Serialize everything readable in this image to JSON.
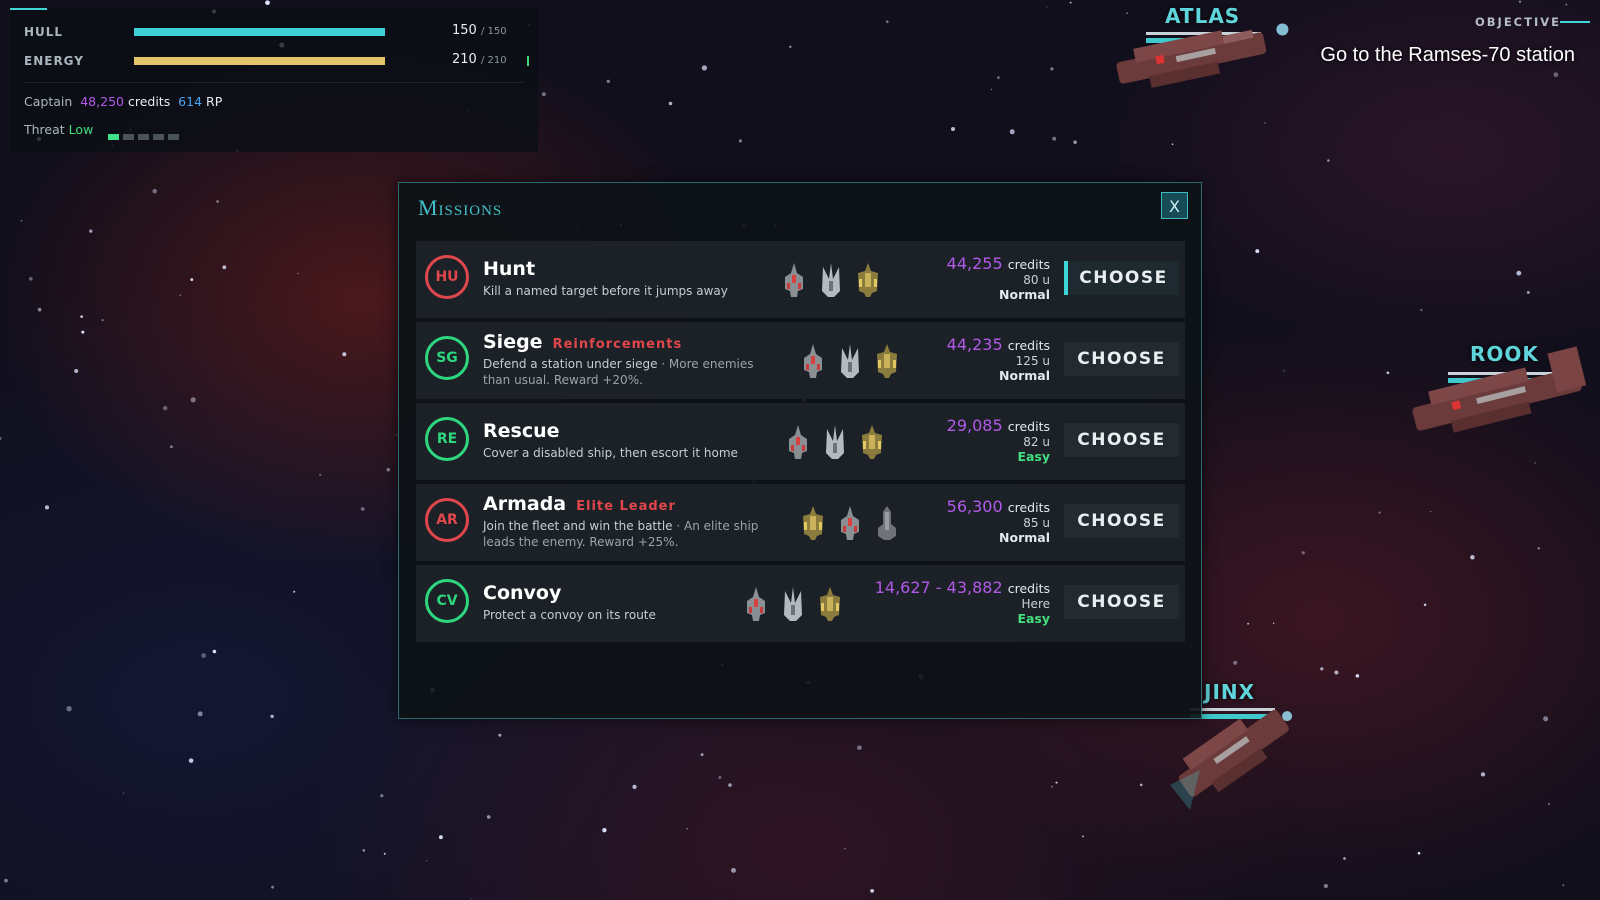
{
  "hud": {
    "hull": {
      "label": "HULL",
      "value": "150",
      "max": "150",
      "fill": 1.0,
      "color": "#3fcfd6"
    },
    "energy": {
      "label": "ENERGY",
      "value": "210",
      "max": "210",
      "fill": 1.0,
      "color": "#e6c56a"
    },
    "captain": {
      "label": "Captain",
      "credits": "48,250",
      "credits_label": "credits",
      "rp": "614",
      "rp_label": "RP"
    },
    "threat": {
      "label": "Threat",
      "level": "Low",
      "pips_total": 5,
      "pips_active": 1
    }
  },
  "objective": {
    "label": "OBJECTIVE",
    "text": "Go to the Ramses-70 station"
  },
  "scene_ships": [
    {
      "name": "ATLAS"
    },
    {
      "name": "ROOK"
    },
    {
      "name": "JINX"
    }
  ],
  "modal": {
    "title": "Missions",
    "close_label": "X",
    "missions": [
      {
        "code": "HU",
        "badge_color": "red",
        "name": "Hunt",
        "tag": "",
        "desc": "Kill a named target before it jumps away",
        "extra": "",
        "credits": "44,255",
        "credits_label": "credits",
        "units": "80 u",
        "difficulty": "Normal",
        "difficulty_class": "normal",
        "choose_label": "CHOOSE",
        "active": true,
        "ships": [
          "fighter",
          "interceptor",
          "gunship"
        ]
      },
      {
        "code": "SG",
        "badge_color": "green",
        "name": "Siege",
        "tag": "Reinforcements",
        "desc": "Defend a station under siege",
        "extra": " · More enemies than usual. Reward +20%.",
        "credits": "44,235",
        "credits_label": "credits",
        "units": "125 u",
        "difficulty": "Normal",
        "difficulty_class": "normal",
        "choose_label": "CHOOSE",
        "active": false,
        "ships": [
          "fighter",
          "interceptor",
          "gunship"
        ]
      },
      {
        "code": "RE",
        "badge_color": "green",
        "name": "Rescue",
        "tag": "",
        "desc": "Cover a disabled ship, then escort it home",
        "extra": "",
        "credits": "29,085",
        "credits_label": "credits",
        "units": "82 u",
        "difficulty": "Easy",
        "difficulty_class": "easy",
        "choose_label": "CHOOSE",
        "active": false,
        "ships": [
          "fighter",
          "interceptor",
          "gunship"
        ]
      },
      {
        "code": "AR",
        "badge_color": "red",
        "name": "Armada",
        "tag": "Elite Leader",
        "desc": "Join the fleet and win the battle",
        "extra": " · An elite ship leads the enemy. Reward +25%.",
        "credits": "56,300",
        "credits_label": "credits",
        "units": "85 u",
        "difficulty": "Normal",
        "difficulty_class": "normal",
        "choose_label": "CHOOSE",
        "active": false,
        "ships": [
          "gunship",
          "fighter",
          "cruiser"
        ]
      },
      {
        "code": "CV",
        "badge_color": "green",
        "name": "Convoy",
        "tag": "",
        "desc": "Protect a convoy on its route",
        "extra": "",
        "credits": "14,627 - 43,882",
        "credits_label": "credits",
        "units": "Here",
        "difficulty": "Easy",
        "difficulty_class": "easy",
        "choose_label": "CHOOSE",
        "active": false,
        "ships": [
          "fighter",
          "interceptor",
          "gunship"
        ]
      }
    ]
  }
}
